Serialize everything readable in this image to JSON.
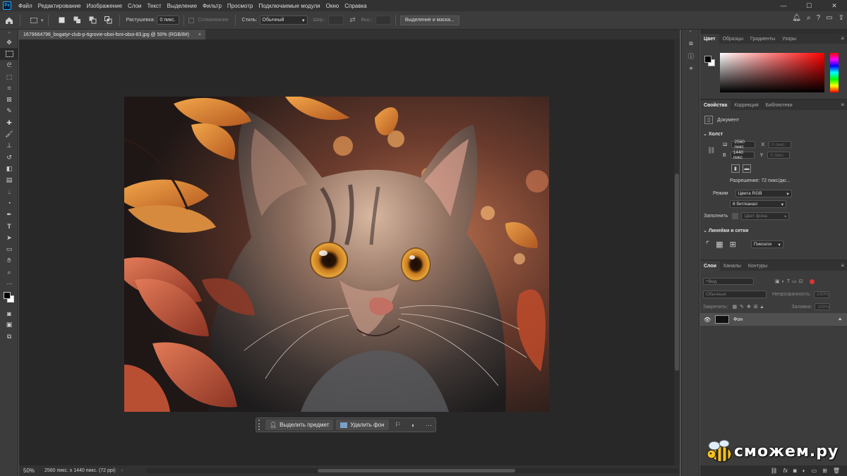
{
  "menu": {
    "logo": "Ps",
    "items": [
      "Файл",
      "Редактирование",
      "Изображение",
      "Слои",
      "Текст",
      "Выделение",
      "Фильтр",
      "Просмотр",
      "Подключаемые модули",
      "Окно",
      "Справка"
    ]
  },
  "window_controls": {
    "minimize": "—",
    "maximize": "☐",
    "close": "✕"
  },
  "options_bar": {
    "feather_label": "Растушевка:",
    "feather_value": "0 пикс.",
    "antialias_label": "Сглаживание",
    "style_label": "Стиль:",
    "style_value": "Обычный",
    "width_label": "Шир.:",
    "height_label": "Выс.:",
    "select_mask_button": "Выделение и маска..."
  },
  "document": {
    "tab_title": "1679664796_bogatyr-club-p-tigrovie-oboi-foni-oboi-83.jpg @ 50% (RGB/8#)",
    "close": "×"
  },
  "statusbar": {
    "zoom": "50%",
    "info": "2560 пикс. x 1440 пикс. (72 ppi)",
    "arrow": "›"
  },
  "taskbar": {
    "select_subject": "Выделить предмет",
    "remove_background": "Удалить фон",
    "more": "···"
  },
  "color_panel": {
    "tabs": [
      "Цвет",
      "Образцы",
      "Градиенты",
      "Узоры"
    ]
  },
  "properties_panel": {
    "tabs": [
      "Свойства",
      "Коррекция",
      "Библиотеки"
    ],
    "doc_label": "Документ",
    "canvas_section": "Холст",
    "w_label": "Ш",
    "w_value": "2560 пикс",
    "h_label": "В",
    "h_value": "1440 пикс",
    "x_label": "X",
    "y_label": "Y",
    "x_placeholder": "0 пикс",
    "y_placeholder": "0 пикс",
    "resolution": "Разрешение: 72 пикс/дю...",
    "mode_label": "Режим",
    "mode_value": "Цвета RGB",
    "depth_value": "8 бит/канал",
    "fill_label": "Заполнить",
    "fill_value": "Цвет фона",
    "rulers_section": "Линейки и сетки",
    "units_value": "Пиксели"
  },
  "layers_panel": {
    "tabs": [
      "Слои",
      "Каналы",
      "Контуры"
    ],
    "search_placeholder": "Вид",
    "blend_mode": "Обычные",
    "opacity_label": "Непрозрачность:",
    "opacity_value": "100%",
    "lock_label": "Закрепить:",
    "fill_label": "Заливка:",
    "fill_value": "100%",
    "layer_name": "Фон"
  },
  "watermark": {
    "text": "сможем.ру"
  },
  "colors": {
    "accent": "#31a8ff",
    "panel": "#3c3c3c",
    "workspace": "#282828"
  }
}
